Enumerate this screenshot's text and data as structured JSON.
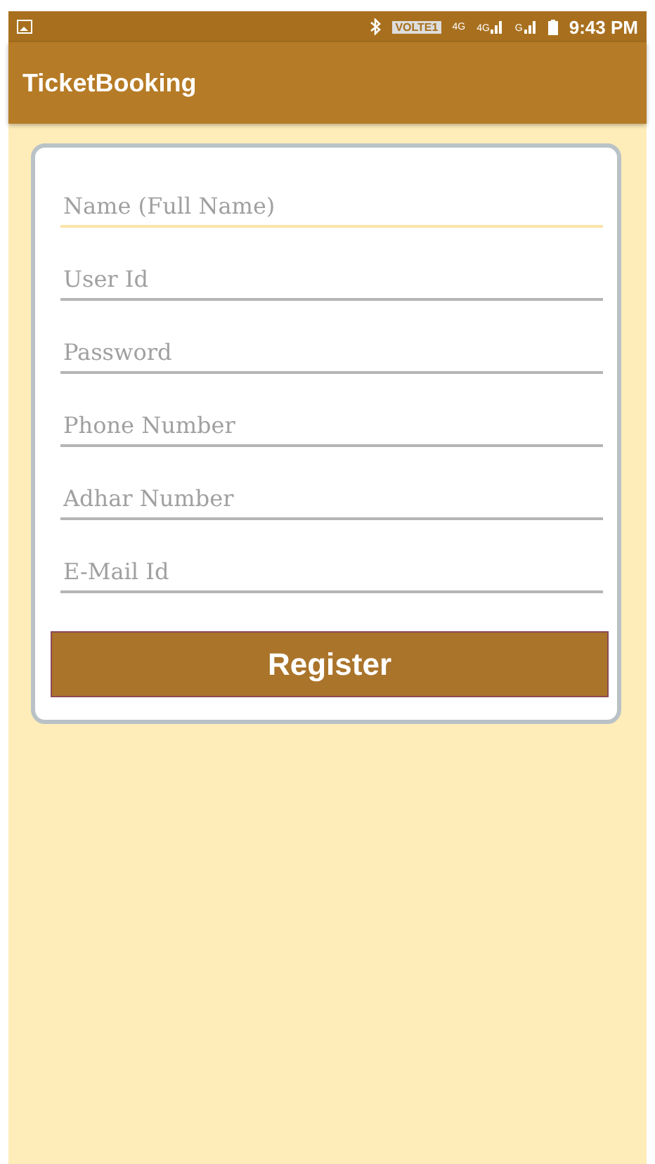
{
  "status_bar": {
    "volte": "VOLTE1",
    "network_1": "4G",
    "network_2": "4G",
    "network_3": "G",
    "time": "9:43 PM"
  },
  "app_bar": {
    "title": "TicketBooking"
  },
  "form": {
    "fields": [
      {
        "placeholder": "Name (Full Name)",
        "focused": true
      },
      {
        "placeholder": "User Id",
        "focused": false
      },
      {
        "placeholder": "Password",
        "focused": false
      },
      {
        "placeholder": "Phone Number",
        "focused": false
      },
      {
        "placeholder": "Adhar Number",
        "focused": false
      },
      {
        "placeholder": "E-Mail Id",
        "focused": false
      }
    ],
    "button": "Register"
  }
}
